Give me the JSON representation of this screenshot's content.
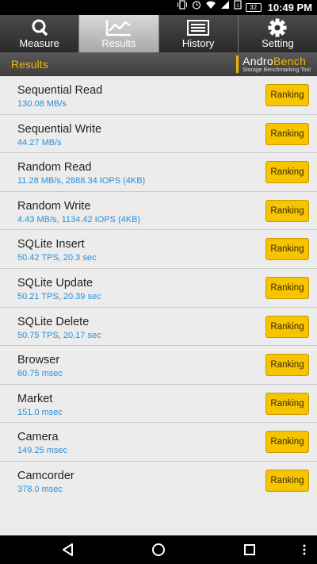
{
  "status_bar": {
    "time": "10:49 PM",
    "battery": "32",
    "icons": [
      "vibrate-icon",
      "alarm-icon",
      "wifi-icon",
      "signal-icon",
      "sim-icon",
      "battery-icon"
    ]
  },
  "tabs": [
    {
      "label": "Measure",
      "icon": "magnifier-icon"
    },
    {
      "label": "Results",
      "icon": "chart-icon",
      "active": true
    },
    {
      "label": "History",
      "icon": "list-icon"
    },
    {
      "label": "Setting",
      "icon": "gear-icon"
    }
  ],
  "header": {
    "title": "Results",
    "logo_main_part1": "Andro",
    "logo_main_part2": "Bench",
    "logo_sub": "Storage Benchmarking Tool"
  },
  "results": [
    {
      "name": "Sequential Read",
      "value": "130.08 MB/s",
      "button": "Ranking"
    },
    {
      "name": "Sequential Write",
      "value": "44.27 MB/s",
      "button": "Ranking"
    },
    {
      "name": "Random Read",
      "value": "11.28 MB/s, 2888.34 IOPS (4KB)",
      "button": "Ranking"
    },
    {
      "name": "Random Write",
      "value": "4.43 MB/s, 1134.42 IOPS (4KB)",
      "button": "Ranking"
    },
    {
      "name": "SQLite Insert",
      "value": "50.42 TPS, 20.3 sec",
      "button": "Ranking"
    },
    {
      "name": "SQLite Update",
      "value": "50.21 TPS, 20.39 sec",
      "button": "Ranking"
    },
    {
      "name": "SQLite Delete",
      "value": "50.75 TPS, 20.17 sec",
      "button": "Ranking"
    },
    {
      "name": "Browser",
      "value": "60.75 msec",
      "button": "Ranking"
    },
    {
      "name": "Market",
      "value": "151.0 msec",
      "button": "Ranking"
    },
    {
      "name": "Camera",
      "value": "149.25 msec",
      "button": "Ranking"
    },
    {
      "name": "Camcorder",
      "value": "378.0 msec",
      "button": "Ranking"
    }
  ],
  "colors": {
    "accent": "#f5b400",
    "value_text": "#2a8fd6",
    "button_bg": "#f7c400"
  }
}
